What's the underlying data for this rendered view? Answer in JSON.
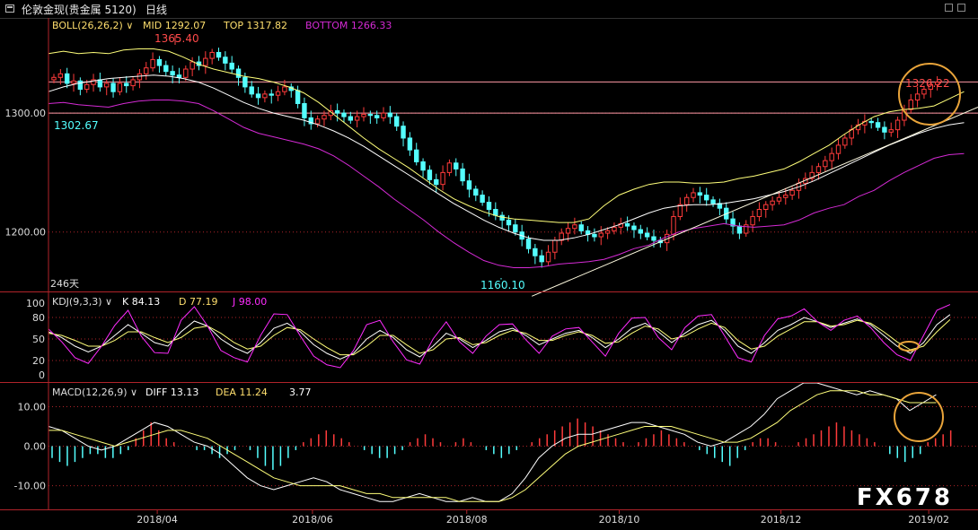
{
  "titlebar": {
    "instrument": "伦敦金现(贵金属 5120)",
    "period": "日线"
  },
  "watermark": "FX678",
  "chart_data": [
    {
      "type": "candlestick",
      "name": "main",
      "legend": {
        "indicator": "BOLL(26,26,2)",
        "mid": "MID 1292.07",
        "top": "TOP 1317.82",
        "bottom": "BOTTOM 1266.33"
      },
      "y_ticks": [
        {
          "label": "1300.00",
          "value": 1300
        },
        {
          "label": "1200.00",
          "value": 1200
        }
      ],
      "ylim": [
        1150,
        1380
      ],
      "horizontal_levels": [
        1326.22,
        1300
      ],
      "annotations": {
        "high": {
          "label": "1365.40",
          "value": 1365.4
        },
        "low": {
          "label": "1160.10",
          "value": 1160.1
        },
        "left_close": {
          "label": "1302.67",
          "value": 1302.67
        },
        "last_high": {
          "label": "1326.22",
          "value": 1326.22
        },
        "bar_count": "246天"
      },
      "closes": [
        1330,
        1333,
        1325,
        1327,
        1320,
        1324,
        1328,
        1322,
        1325,
        1318,
        1325,
        1323,
        1328,
        1333,
        1338,
        1345,
        1340,
        1335,
        1332,
        1330,
        1337,
        1343,
        1340,
        1346,
        1351,
        1347,
        1342,
        1337,
        1330,
        1322,
        1316,
        1313,
        1316,
        1315,
        1318,
        1322,
        1319,
        1308,
        1296,
        1291,
        1295,
        1298,
        1302,
        1300,
        1297,
        1294,
        1297,
        1299,
        1298,
        1296,
        1300,
        1297,
        1289,
        1279,
        1269,
        1259,
        1252,
        1244,
        1240,
        1250,
        1258,
        1253,
        1243,
        1236,
        1231,
        1225,
        1219,
        1214,
        1210,
        1206,
        1200,
        1194,
        1186,
        1180,
        1175,
        1183,
        1193,
        1199,
        1203,
        1206,
        1201,
        1198,
        1196,
        1199,
        1201,
        1204,
        1207,
        1205,
        1202,
        1199,
        1196,
        1193,
        1191,
        1198,
        1213,
        1223,
        1229,
        1233,
        1231,
        1227,
        1224,
        1220,
        1211,
        1205,
        1199,
        1206,
        1213,
        1219,
        1223,
        1226,
        1229,
        1231,
        1235,
        1241,
        1245,
        1250,
        1255,
        1260,
        1266,
        1273,
        1279,
        1286,
        1290,
        1293,
        1292,
        1288,
        1284,
        1286,
        1294,
        1303,
        1311,
        1316,
        1320,
        1324,
        1326
      ],
      "series": [
        {
          "name": "MID",
          "values": [
            1318,
            1322,
            1325,
            1327,
            1329,
            1330,
            1331,
            1332,
            1331,
            1329,
            1326,
            1321,
            1315,
            1309,
            1304,
            1300,
            1297,
            1294,
            1290,
            1285,
            1279,
            1272,
            1264,
            1256,
            1248,
            1240,
            1232,
            1224,
            1217,
            1210,
            1204,
            1199,
            1195,
            1193,
            1193,
            1195,
            1198,
            1202,
            1206,
            1211,
            1216,
            1220,
            1222,
            1223,
            1223,
            1224,
            1226,
            1228,
            1231,
            1234,
            1238,
            1243,
            1249,
            1255,
            1261,
            1267,
            1273,
            1278,
            1283,
            1287,
            1290,
            1292
          ]
        },
        {
          "name": "TOP",
          "values": [
            1350,
            1352,
            1350,
            1351,
            1350,
            1353,
            1354,
            1354,
            1352,
            1347,
            1341,
            1337,
            1334,
            1331,
            1329,
            1326,
            1322,
            1317,
            1309,
            1299,
            1289,
            1279,
            1270,
            1262,
            1254,
            1245,
            1236,
            1228,
            1222,
            1217,
            1213,
            1211,
            1210,
            1209,
            1208,
            1208,
            1211,
            1222,
            1231,
            1236,
            1240,
            1242,
            1242,
            1241,
            1241,
            1242,
            1245,
            1247,
            1250,
            1253,
            1259,
            1266,
            1273,
            1282,
            1290,
            1297,
            1301,
            1303,
            1304,
            1306,
            1312,
            1318
          ]
        },
        {
          "name": "BOTTOM",
          "values": [
            1308,
            1309,
            1307,
            1306,
            1305,
            1308,
            1310,
            1311,
            1311,
            1310,
            1308,
            1302,
            1295,
            1288,
            1283,
            1280,
            1277,
            1274,
            1270,
            1264,
            1256,
            1247,
            1238,
            1228,
            1219,
            1210,
            1200,
            1191,
            1183,
            1176,
            1172,
            1170,
            1170,
            1171,
            1173,
            1174,
            1175,
            1177,
            1181,
            1186,
            1189,
            1195,
            1200,
            1203,
            1205,
            1207,
            1205,
            1204,
            1205,
            1206,
            1210,
            1216,
            1220,
            1223,
            1230,
            1235,
            1243,
            1250,
            1256,
            1262,
            1265,
            1266
          ]
        }
      ],
      "trendline": [
        [
          0.52,
          1146
        ],
        [
          1.0,
          1305
        ]
      ]
    },
    {
      "type": "line",
      "name": "kdj",
      "legend": {
        "indicator": "KDJ(9,3,3)",
        "k": "K 84.13",
        "d": "D 77.19",
        "j": "J 98.00"
      },
      "y_ticks": [
        {
          "label": "100",
          "value": 100
        },
        {
          "label": "80",
          "value": 80
        },
        {
          "label": "50",
          "value": 50
        },
        {
          "label": "20",
          "value": 20
        },
        {
          "label": "0",
          "value": 0
        }
      ],
      "ylim": [
        -10,
        115
      ],
      "series": [
        {
          "name": "K",
          "values": [
            60,
            52,
            40,
            32,
            40,
            55,
            70,
            58,
            45,
            40,
            60,
            75,
            68,
            50,
            38,
            30,
            45,
            65,
            72,
            60,
            42,
            30,
            22,
            30,
            50,
            62,
            52,
            35,
            25,
            40,
            58,
            50,
            38,
            48,
            60,
            65,
            55,
            42,
            50,
            58,
            62,
            52,
            38,
            50,
            65,
            72,
            60,
            45,
            58,
            70,
            76,
            62,
            40,
            30,
            45,
            62,
            70,
            80,
            74,
            66,
            72,
            78,
            70,
            55,
            40,
            30,
            45,
            70,
            84
          ]
        },
        {
          "name": "D",
          "values": [
            58,
            55,
            48,
            40,
            40,
            48,
            60,
            60,
            52,
            45,
            52,
            65,
            68,
            58,
            45,
            36,
            40,
            55,
            66,
            63,
            50,
            38,
            28,
            28,
            40,
            55,
            55,
            42,
            30,
            35,
            50,
            52,
            42,
            45,
            55,
            62,
            58,
            48,
            48,
            55,
            60,
            55,
            44,
            46,
            58,
            68,
            64,
            50,
            54,
            64,
            72,
            66,
            48,
            36,
            40,
            54,
            64,
            74,
            74,
            68,
            70,
            76,
            72,
            60,
            46,
            35,
            40,
            60,
            77
          ]
        },
        {
          "name": "J",
          "values": [
            64,
            46,
            24,
            16,
            40,
            69,
            90,
            54,
            31,
            30,
            76,
            95,
            68,
            34,
            24,
            18,
            55,
            85,
            84,
            54,
            26,
            14,
            10,
            34,
            70,
            76,
            46,
            21,
            15,
            50,
            74,
            46,
            30,
            54,
            70,
            71,
            49,
            30,
            54,
            64,
            66,
            46,
            26,
            58,
            79,
            80,
            52,
            35,
            66,
            82,
            84,
            54,
            24,
            18,
            55,
            78,
            82,
            92,
            74,
            62,
            76,
            82,
            66,
            45,
            28,
            20,
            55,
            90,
            98
          ]
        }
      ]
    },
    {
      "type": "bar",
      "name": "macd",
      "legend": {
        "indicator": "MACD(12,26,9)",
        "diff": "DIFF 13.13",
        "dea": "DEA 11.24",
        "macd": "3.77"
      },
      "y_ticks": [
        {
          "label": "10.00",
          "value": 10
        },
        {
          "label": "0.00",
          "value": 0
        },
        {
          "label": "-10.00",
          "value": -10
        }
      ],
      "ylim": [
        -16,
        16
      ],
      "histogram": [
        -3,
        -4,
        -5,
        -4,
        -3,
        -2,
        -2,
        -3,
        -3,
        -2,
        -1,
        2,
        4,
        6,
        4,
        2,
        1,
        0,
        0,
        -1,
        -1,
        -2,
        -3,
        -2,
        -1,
        0,
        -1,
        -3,
        -5,
        -6,
        -5,
        -3,
        -1,
        1,
        2,
        3,
        4,
        3,
        2,
        1,
        0,
        -1,
        -2,
        -3,
        -3,
        -2,
        -1,
        1,
        2,
        3,
        2,
        1,
        0,
        1,
        2,
        1,
        0,
        -1,
        -2,
        -3,
        -2,
        -1,
        0,
        1,
        2,
        3,
        4,
        5,
        6,
        7,
        6,
        5,
        4,
        3,
        2,
        1,
        0,
        1,
        2,
        3,
        4,
        3,
        2,
        1,
        0,
        -1,
        -2,
        -3,
        -4,
        -5,
        -3,
        -1,
        1,
        2,
        2,
        1,
        0,
        0,
        1,
        2,
        3,
        4,
        5,
        6,
        5,
        4,
        3,
        2,
        1,
        0,
        -2,
        -3,
        -4,
        -3,
        -2,
        1,
        2,
        3,
        4
      ],
      "series": [
        {
          "name": "DIFF",
          "values": [
            5,
            4,
            2,
            0,
            -1,
            0,
            2,
            4,
            6,
            5,
            3,
            1,
            0,
            -2,
            -5,
            -8,
            -10,
            -11,
            -10,
            -9,
            -8,
            -9,
            -11,
            -12,
            -13,
            -14,
            -14,
            -13,
            -12,
            -13,
            -14,
            -14,
            -13,
            -14,
            -14,
            -12,
            -8,
            -3,
            0,
            2,
            3,
            3,
            4,
            5,
            6,
            6,
            5,
            4,
            3,
            1,
            0,
            1,
            3,
            5,
            8,
            12,
            14,
            16,
            16,
            15,
            14,
            13,
            14,
            13,
            12,
            9,
            11,
            13
          ]
        },
        {
          "name": "DEA",
          "values": [
            4,
            4,
            3,
            2,
            1,
            0,
            1,
            2,
            3,
            4,
            4,
            3,
            2,
            0,
            -2,
            -4,
            -6,
            -8,
            -9,
            -10,
            -10,
            -10,
            -10,
            -11,
            -12,
            -12,
            -13,
            -13,
            -13,
            -13,
            -13,
            -14,
            -14,
            -14,
            -14,
            -13,
            -11,
            -8,
            -5,
            -2,
            0,
            1,
            2,
            3,
            4,
            5,
            5,
            5,
            4,
            3,
            2,
            1,
            1,
            2,
            4,
            6,
            9,
            11,
            13,
            14,
            14,
            14,
            13,
            13,
            12,
            11,
            11,
            11
          ]
        }
      ]
    }
  ],
  "x_axis": {
    "ticks": [
      {
        "label": "2018/04",
        "pos": 0.117
      },
      {
        "label": "2018/06",
        "pos": 0.284
      },
      {
        "label": "2018/08",
        "pos": 0.45
      },
      {
        "label": "2018/10",
        "pos": 0.614
      },
      {
        "label": "2018/12",
        "pos": 0.788
      },
      {
        "label": "2019/02",
        "pos": 0.947
      }
    ]
  },
  "colors": {
    "up": "#ff3b3b",
    "down": "#54ffff",
    "mid": "#ffffff",
    "top": "#ffff7a",
    "bottom": "#d42ad4",
    "k": "#ffffff",
    "d": "#ffff7a",
    "j": "#ff2cff",
    "diff": "#ffffff",
    "dea": "#ffff7a",
    "grid": "#b0242a",
    "level": "#ff9aa6",
    "axis": "#b0242a",
    "circle": "#e9a43a",
    "label_red": "#ff4a4a",
    "label_cyan": "#54ffff"
  }
}
